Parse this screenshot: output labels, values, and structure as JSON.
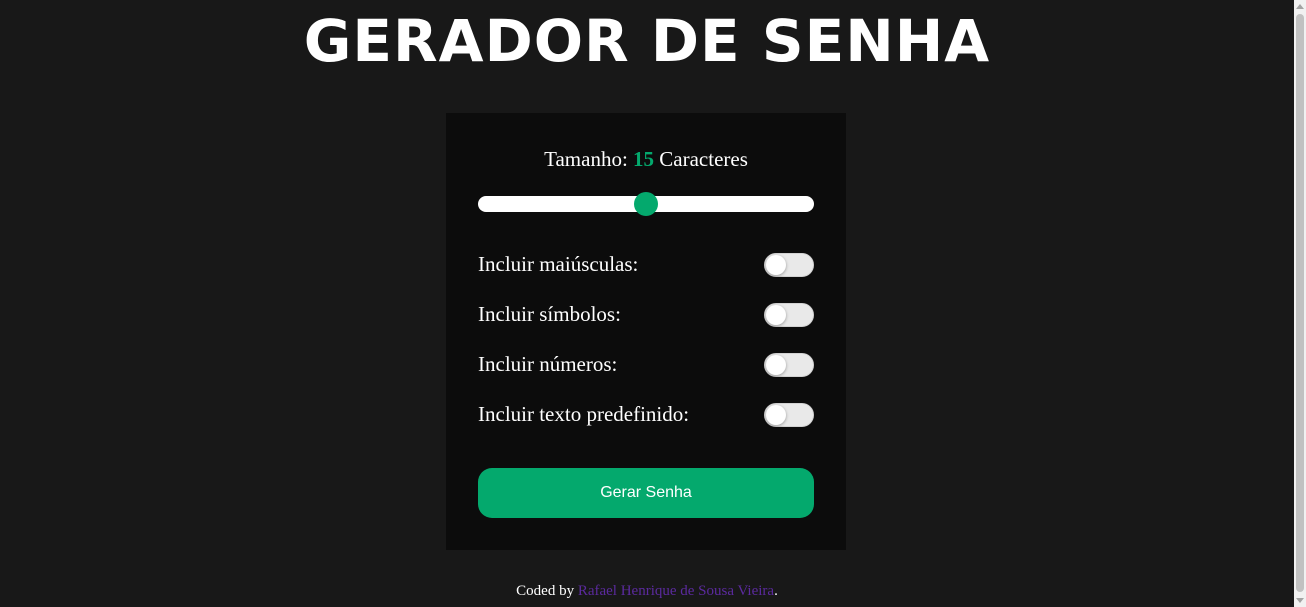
{
  "header": {
    "title": "GERADOR DE SENHA"
  },
  "card": {
    "size_prefix": "Tamanho:",
    "size_value": "15",
    "size_suffix": "Caracteres",
    "slider_fraction": 0.5,
    "options": [
      {
        "label": "Incluir maiúsculas:",
        "checked": false
      },
      {
        "label": "Incluir símbolos:",
        "checked": false
      },
      {
        "label": "Incluir números:",
        "checked": false
      },
      {
        "label": "Incluir texto predefinido:",
        "checked": false
      }
    ],
    "generate_label": "Gerar Senha"
  },
  "footer": {
    "prefix": "Coded by",
    "author": "Rafael Henrique de Sousa Vieira",
    "suffix": "."
  },
  "colors": {
    "background": "#181818",
    "card": "#0c0c0c",
    "accent": "#04a96d",
    "link": "#5b2a9e"
  }
}
